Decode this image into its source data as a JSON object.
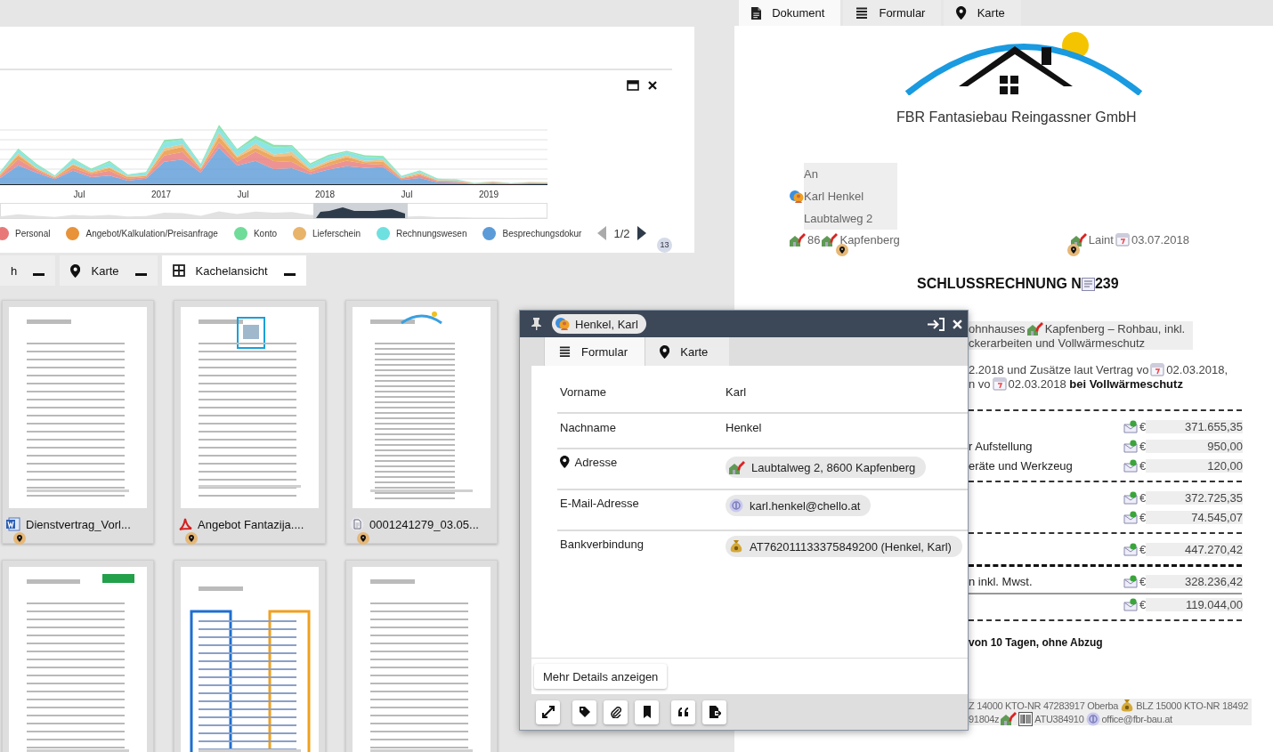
{
  "top_panel": {
    "x_labels": [
      "Jul",
      "2017",
      "Jul",
      "2018",
      "Jul",
      "2019"
    ],
    "legend": [
      {
        "label": "Personal",
        "color": "#e87878"
      },
      {
        "label": "Angebot/Kalkulation/Preisanfrage",
        "color": "#e8923a"
      },
      {
        "label": "Konto",
        "color": "#6fdc9a"
      },
      {
        "label": "Lieferschein",
        "color": "#e8b46a"
      },
      {
        "label": "Rechnungswesen",
        "color": "#6fe0e0"
      },
      {
        "label": "Besprechungsdokur",
        "color": "#5b9bd8"
      }
    ],
    "legend_page": "1/2",
    "badge": "13"
  },
  "view_tabs": [
    {
      "label": "h",
      "kind": "list",
      "selected": false
    },
    {
      "label": "Karte",
      "kind": "map",
      "selected": false
    },
    {
      "label": "Kachelansicht",
      "kind": "tiles",
      "selected": true
    }
  ],
  "tiles": [
    {
      "caption": "Dienstvertrag_Vorl...",
      "kind": "word"
    },
    {
      "caption": "Angebot Fantazija....",
      "kind": "pdf"
    },
    {
      "caption": "0001241279_03.05...",
      "kind": "scan"
    },
    {
      "kind": "cut"
    },
    {
      "kind": "cut"
    },
    {
      "kind": "cut"
    }
  ],
  "document": {
    "tabs": [
      {
        "label": "Dokument",
        "kind": "file",
        "selected": true
      },
      {
        "label": "Formular",
        "kind": "form",
        "selected": false
      },
      {
        "label": "Karte",
        "kind": "map",
        "selected": false
      }
    ],
    "company": "FBR Fantasiebau Reingassner GmbH",
    "recipient": [
      "An",
      "Karl Henkel",
      "Laubtalweg 2"
    ],
    "city_prefix": "86",
    "city": "Kapfenberg",
    "place": "Laint",
    "date": "03.07.2018",
    "title": "SCHLUSSRECHNUNG N",
    "number": "239",
    "intro": [
      {
        "shaded": true,
        "segments": [
          {
            "kind": "text",
            "text": "ohnhauses"
          },
          {
            "kind": "house"
          },
          {
            "kind": "text",
            "text": "Kapfenberg – Rohbau, inkl."
          }
        ]
      },
      {
        "shaded": true,
        "segments": [
          {
            "kind": "text",
            "text": "ckerarbeiten und Vollwärmeschutz"
          }
        ]
      },
      {
        "shaded": false,
        "segments": [
          {
            "kind": "text",
            "text": "2.2018 und Zusätze laut Vertrag vo"
          },
          {
            "kind": "calendar"
          },
          {
            "kind": "text",
            "text": "02.03.2018,"
          }
        ]
      },
      {
        "shaded": false,
        "segments": [
          {
            "kind": "text",
            "text": "n vo"
          },
          {
            "kind": "calendar"
          },
          {
            "kind": "text",
            "text": "02.03.2018 **bei Vollwärmeschutz**"
          }
        ]
      }
    ],
    "rows": [
      {
        "kind": "dash"
      },
      {
        "kind": "row",
        "currency": "€",
        "amount": "371.655,35"
      },
      {
        "kind": "row",
        "label": "r Aufstellung",
        "currency": "€",
        "amount": "950,00"
      },
      {
        "kind": "row",
        "label": "eräte und Werkzeug",
        "currency": "€",
        "amount": "120,00"
      },
      {
        "kind": "dash"
      },
      {
        "kind": "row",
        "currency": "€",
        "amount": "372.725,35"
      },
      {
        "kind": "row",
        "currency": "€",
        "amount": "74.545,07"
      },
      {
        "kind": "dash"
      },
      {
        "kind": "row",
        "currency": "€",
        "amount": "447.270,42"
      },
      {
        "kind": "thick"
      },
      {
        "kind": "row",
        "label": "n inkl. Mwst.",
        "currency": "€",
        "amount": "328.236,42"
      },
      {
        "kind": "solid"
      },
      {
        "kind": "row",
        "currency": "€",
        "amount": "119.044,00"
      },
      {
        "kind": "dash"
      }
    ],
    "payment_note": "von 10 Tagen, ohne Abzug",
    "footer": [
      {
        "segments": [
          {
            "kind": "text",
            "text": "Z 14000 KTO-NR 47283917 Oberba"
          },
          {
            "kind": "money"
          },
          {
            "kind": "text",
            "text": "BLZ 15000 KTO-NR 18492"
          }
        ]
      },
      {
        "segments": [
          {
            "kind": "text",
            "text": "91804z"
          },
          {
            "kind": "house"
          },
          {
            "kind": "barcode"
          },
          {
            "kind": "text",
            "text": "ATU384910"
          },
          {
            "kind": "email"
          },
          {
            "kind": "text",
            "text": "office@fbr-bau.at"
          }
        ]
      }
    ]
  },
  "popup": {
    "chip": "Henkel, Karl",
    "tabs": [
      {
        "label": "Formular",
        "kind": "form",
        "selected": true
      },
      {
        "label": "Karte",
        "kind": "map",
        "selected": false
      }
    ],
    "fields": [
      {
        "label": "Vorname",
        "value": "Karl",
        "kind": "plain"
      },
      {
        "label": "Nachname",
        "value": "Henkel",
        "kind": "plain"
      },
      {
        "label": "Adresse",
        "value": "Laubtalweg 2, 8600 Kapfenberg",
        "kind": "address"
      },
      {
        "label": "E-Mail-Adresse",
        "value": "karl.henkel@chello.at",
        "kind": "email"
      },
      {
        "label": "Bankverbindung",
        "value": "AT762011133375849200 (Henkel, Karl)",
        "kind": "bank"
      }
    ],
    "more_button": "Mehr Details anzeigen",
    "toolbar": [
      {
        "kind": "expand"
      },
      {
        "kind": "tag"
      },
      {
        "kind": "attach"
      },
      {
        "kind": "bookmark"
      },
      {
        "kind": "quote"
      },
      {
        "kind": "export"
      }
    ]
  }
}
